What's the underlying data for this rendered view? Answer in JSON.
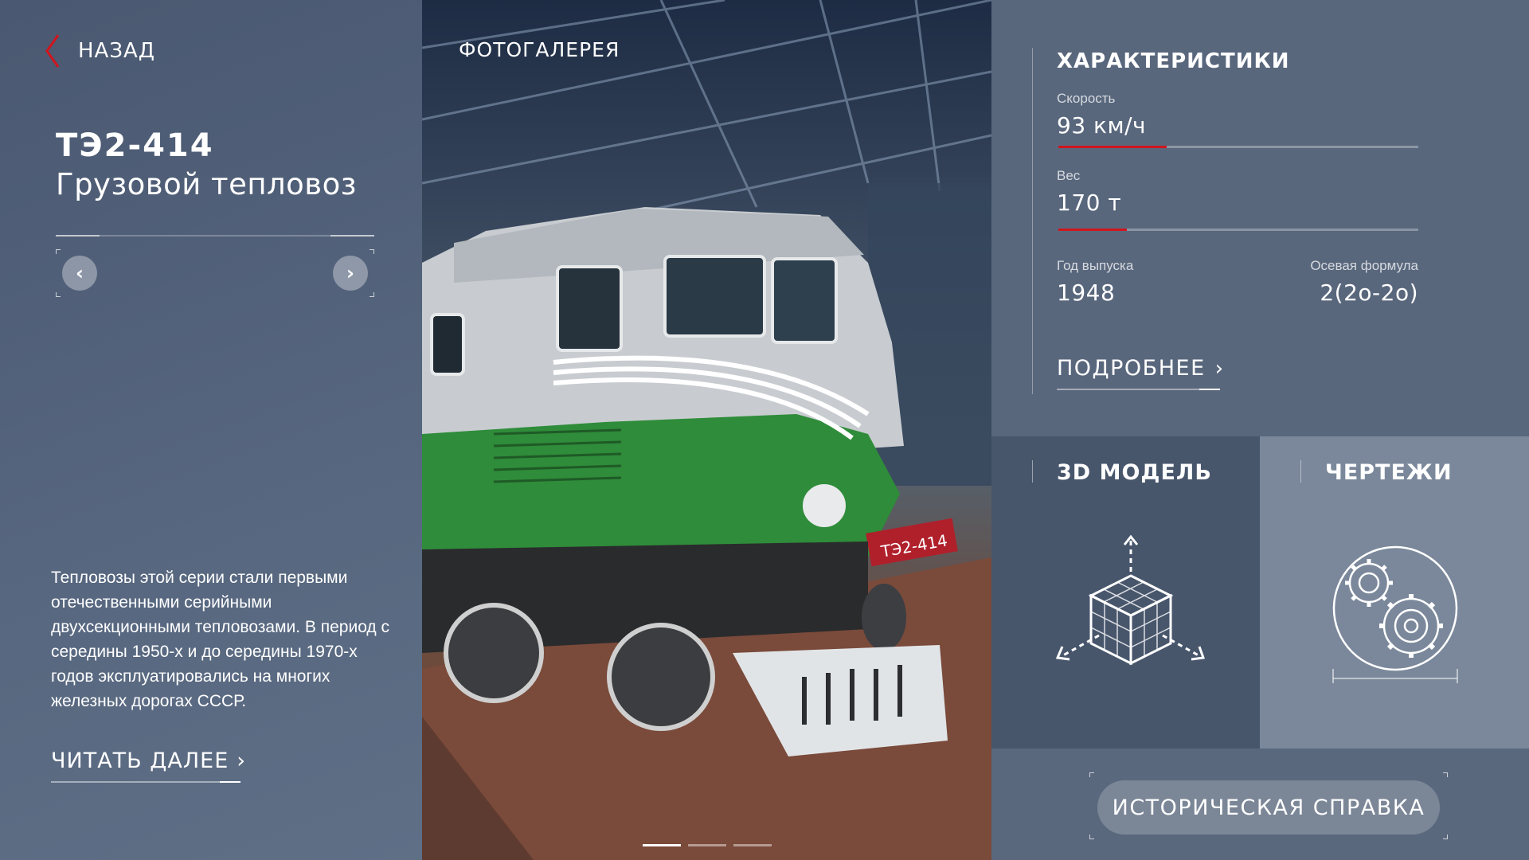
{
  "nav": {
    "back_label": "НАЗАД"
  },
  "locomotive": {
    "id": "ТЭ2-414",
    "type": "Грузовой тепловоз",
    "description": "Тепловозы этой серии стали первыми отечественными серийными двухсекционными тепловозами. В период с середины 1950-х и до середины 1970-х годов эксплуатировались на многих железных дорогах СССР.",
    "read_more_label": "ЧИТАТЬ ДАЛЕЕ",
    "plate_number": "ТЭ2-414"
  },
  "gallery": {
    "title": "ФОТОГАЛЕРЕЯ",
    "slide_count": 3,
    "active_slide": 0
  },
  "specs": {
    "title": "ХАРАКТЕРИСТИКИ",
    "speed": {
      "label": "Скорость",
      "value": "93 км/ч",
      "level": 0.3
    },
    "weight": {
      "label": "Вес",
      "value": "170 т",
      "level": 0.19
    },
    "year": {
      "label": "Год выпуска",
      "value": "1948"
    },
    "axle_formula": {
      "label": "Осевая формула",
      "value": "2(2о-2о)"
    },
    "more_label": "ПОДРОБНЕЕ"
  },
  "tiles": {
    "model_3d": {
      "title": "3D МОДЕЛЬ",
      "icon": "cube-axes-icon"
    },
    "drawings": {
      "title": "ЧЕРТЕЖИ",
      "icon": "gears-icon"
    }
  },
  "history": {
    "button_label": "ИСТОРИЧЕСКАЯ СПРАВКА"
  },
  "colors": {
    "accent": "#d0151e",
    "left_bg": "#4f5e77",
    "specs_bg": "#59677d",
    "tile_3d_bg": "#48566c",
    "tile_draw_bg": "#7b889b"
  }
}
